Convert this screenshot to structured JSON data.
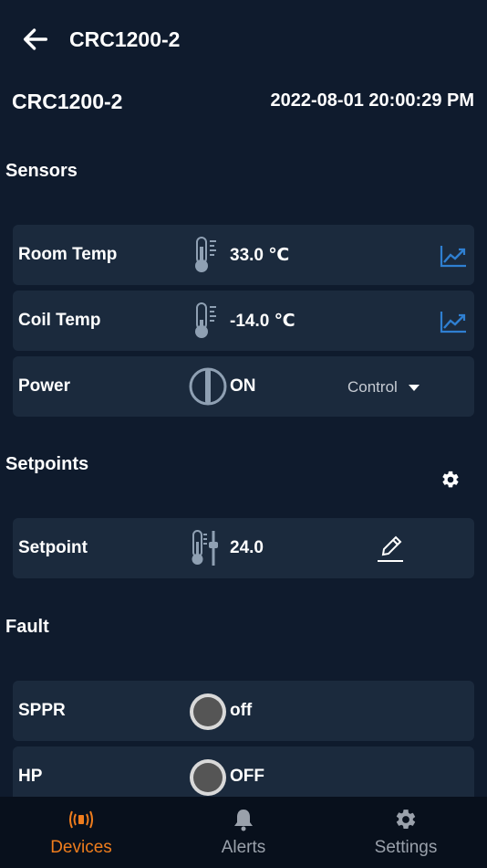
{
  "appbar": {
    "title": "CRC1200-2"
  },
  "device": {
    "name": "CRC1200-2",
    "timestamp": "2022-08-01 20:00:29 PM"
  },
  "sections": {
    "sensors": "Sensors",
    "setpoints": "Setpoints",
    "fault": "Fault"
  },
  "sensors": [
    {
      "label": "Room Temp",
      "value": "33.0 ℃",
      "icon": "thermometer-icon"
    },
    {
      "label": "Coil Temp",
      "value": "-14.0 ℃",
      "icon": "thermometer-icon"
    }
  ],
  "power": {
    "label": "Power",
    "value": "ON",
    "control_label": "Control"
  },
  "setpoint": {
    "label": "Setpoint",
    "value": "24.0"
  },
  "faults": [
    {
      "label": "SPPR",
      "value": "off"
    },
    {
      "label": "HP",
      "value": "OFF"
    }
  ],
  "nav": [
    {
      "label": "Devices",
      "icon": "broadcast-icon",
      "active": true
    },
    {
      "label": "Alerts",
      "icon": "bell-icon",
      "active": false
    },
    {
      "label": "Settings",
      "icon": "gear-icon",
      "active": false
    }
  ],
  "colors": {
    "background": "#0f1b2d",
    "card": "#1b2a3d",
    "accent": "#ef7d1d",
    "chart": "#2f7fd1"
  }
}
